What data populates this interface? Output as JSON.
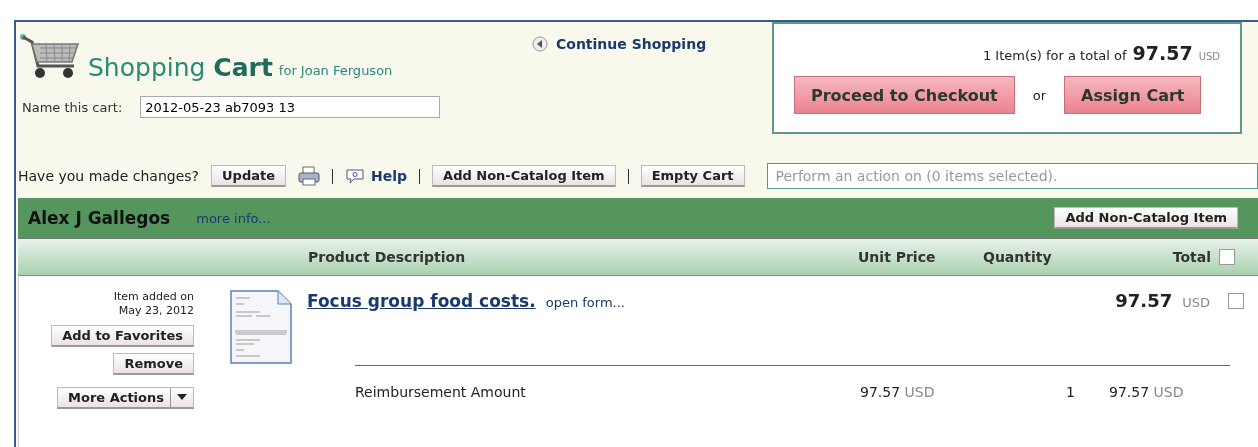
{
  "header": {
    "title_light": "Shopping",
    "title_bold": "Cart",
    "for_text": "for Joan Ferguson",
    "continue_link": "Continue Shopping",
    "cart_name_label": "Name this cart:",
    "cart_name_value": "2012-05-23 ab7093 13"
  },
  "summary": {
    "count_text": "1 Item(s)  for a total of",
    "total": "97.57",
    "currency": "USD",
    "checkout_button": "Proceed to Checkout",
    "or_text": "or",
    "assign_button": "Assign Cart"
  },
  "toolbar": {
    "prompt": "Have you made changes?",
    "update_button": "Update",
    "help_link": "Help",
    "add_item_button": "Add Non-Catalog Item",
    "empty_button": "Empty Cart",
    "action_placeholder": "Perform an action on (0 items selected)."
  },
  "group": {
    "name": "Alex J Gallegos",
    "more_info": "more info...",
    "add_item_button": "Add Non-Catalog Item"
  },
  "columns": {
    "description": "Product Description",
    "unit_price": "Unit Price",
    "quantity": "Quantity",
    "total": "Total",
    "select_all_checked": false
  },
  "items": [
    {
      "added_label": "Item added on",
      "added_date": "May 23, 2012",
      "favorites_button": "Add to Favorites",
      "remove_button": "Remove",
      "more_actions_button": "More Actions",
      "title": "Focus group food costs.",
      "open_form": "open form...",
      "total": "97.57",
      "currency": "USD",
      "checked": false,
      "lines": [
        {
          "name": "Reimbursement Amount",
          "unit_price": "97.57",
          "unit_currency": "USD",
          "quantity": "1",
          "total": "97.57",
          "total_currency": "USD"
        }
      ]
    }
  ]
}
